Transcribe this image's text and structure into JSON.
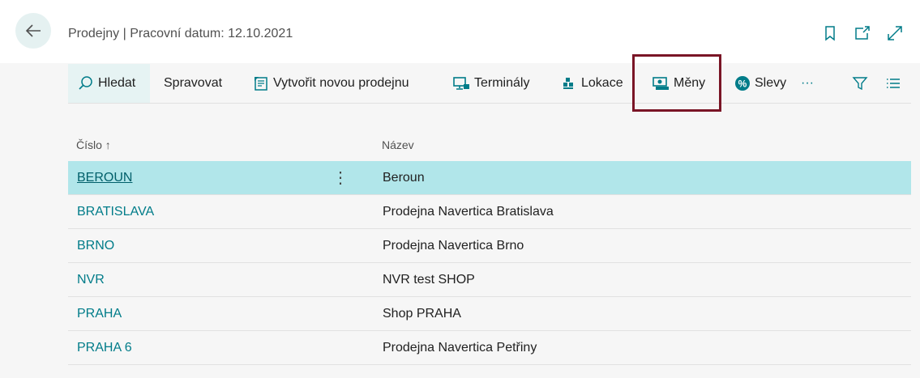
{
  "header": {
    "title": "Prodejny | Pracovní datum: 12.10.2021",
    "icons": [
      "bookmark-icon",
      "open-new-window-icon",
      "expand-icon"
    ]
  },
  "actions": {
    "search": "Hledat",
    "manage": "Spravovat",
    "new_store": "Vytvořit novou prodejnu",
    "terminals": "Terminály",
    "locations": "Lokace",
    "currencies": "Měny",
    "discounts": "Slevy",
    "more": "···"
  },
  "columns": {
    "code": "Číslo",
    "code_sort": "↑",
    "name": "Název"
  },
  "rows": [
    {
      "code": "BEROUN",
      "name": "Beroun"
    },
    {
      "code": "BRATISLAVA",
      "name": "Prodejna Navertica Bratislava"
    },
    {
      "code": "BRNO",
      "name": "Prodejna Navertica Brno"
    },
    {
      "code": "NVR",
      "name": "NVR test SHOP"
    },
    {
      "code": "PRAHA",
      "name": "Shop PRAHA"
    },
    {
      "code": "PRAHA 6",
      "name": "Prodejna Navertica Petřiny"
    }
  ],
  "row_menu_glyph": "⋮",
  "colors": {
    "accent": "#007c89",
    "selected_row": "#b1e6ea",
    "highlight_border": "#7a1526"
  }
}
